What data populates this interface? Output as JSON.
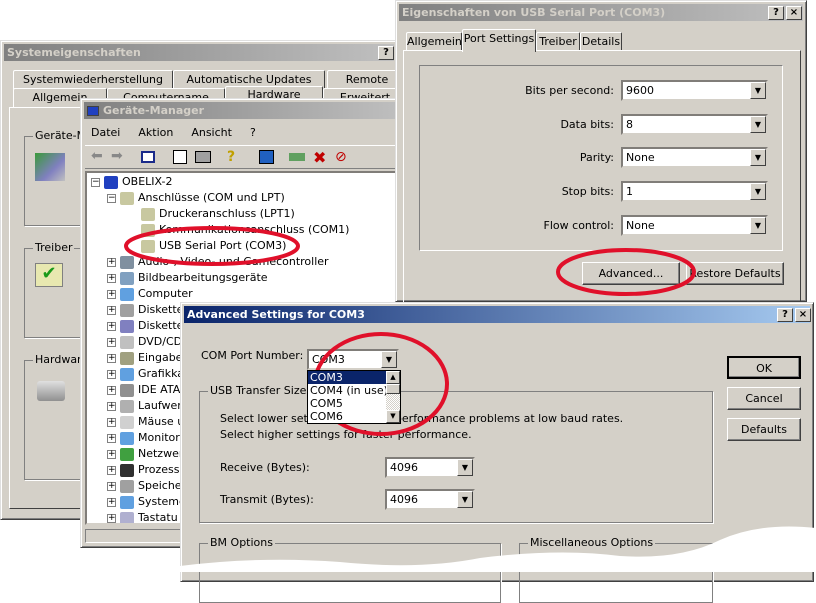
{
  "system_properties": {
    "title": "Systemeigenschaften",
    "help": "?",
    "tabs_row1": [
      "Systemwiederherstellung",
      "Automatische Updates",
      "Remote"
    ],
    "tabs_row2": [
      "Allgemein",
      "Computername",
      "Hardware",
      "Erweitert"
    ],
    "groups": [
      "Geräte-M",
      "Treiber",
      "Hardware"
    ]
  },
  "device_manager": {
    "title": "Geräte-Manager",
    "menu": [
      "Datei",
      "Aktion",
      "Ansicht",
      "?"
    ],
    "toolbar_icons": [
      "back-icon",
      "forward-icon",
      "show-hide-tree-icon",
      "properties-icon",
      "print-icon",
      "help-icon",
      "scan-hardware-icon",
      "update-driver-icon",
      "uninstall-icon",
      "disable-icon"
    ],
    "root": "OBELIX-2",
    "ports_category": "Anschlüsse (COM und LPT)",
    "ports": [
      "Druckeranschluss (LPT1)",
      "Kommunikationsanschluss (COM1)",
      "USB Serial Port (COM3)"
    ],
    "categories": [
      "Audio-, Video- und Gamecontroller",
      "Bildbearbeitungsgeräte",
      "Computer",
      "Diskette",
      "Diskette",
      "DVD/CD",
      "Eingabe",
      "Grafikka",
      "IDE ATA",
      "Laufwer",
      "Mäuse u",
      "Monitor",
      "Netzwer",
      "Prozess",
      "Speiche",
      "Systemg",
      "Tastatu"
    ]
  },
  "port_properties": {
    "title": "Eigenschaften von USB Serial Port (COM3)",
    "help": "?",
    "close": "×",
    "tabs": [
      "Allgemein",
      "Port Settings",
      "Treiber",
      "Details"
    ],
    "active_tab": "Port Settings",
    "fields": [
      {
        "label": "Bits per second:",
        "value": "9600"
      },
      {
        "label": "Data bits:",
        "value": "8"
      },
      {
        "label": "Parity:",
        "value": "None"
      },
      {
        "label": "Stop bits:",
        "value": "1"
      },
      {
        "label": "Flow control:",
        "value": "None"
      }
    ],
    "advanced_button": "Advanced...",
    "restore_button": "Restore Defaults"
  },
  "advanced": {
    "title": "Advanced Settings for COM3",
    "help": "?",
    "close": "×",
    "com_port_label": "COM Port Number:",
    "com_port_value": "COM3",
    "com_options": [
      "COM3",
      "COM4 (in use)",
      "COM5",
      "COM6"
    ],
    "usb_group": "USB Transfer Sizes",
    "hint1": "Select lower settings to correct performance problems at low baud rates.",
    "hint2": "Select higher settings for faster performance.",
    "receive_label": "Receive (Bytes):",
    "receive_value": "4096",
    "transmit_label": "Transmit (Bytes):",
    "transmit_value": "4096",
    "bm_group": "BM Options",
    "misc_group": "Miscellaneous Options",
    "ok": "OK",
    "cancel": "Cancel",
    "defaults": "Defaults"
  },
  "colors": {
    "highlight": "#0a246a",
    "annotation": "#e0102a",
    "face": "#d4d0c8"
  }
}
